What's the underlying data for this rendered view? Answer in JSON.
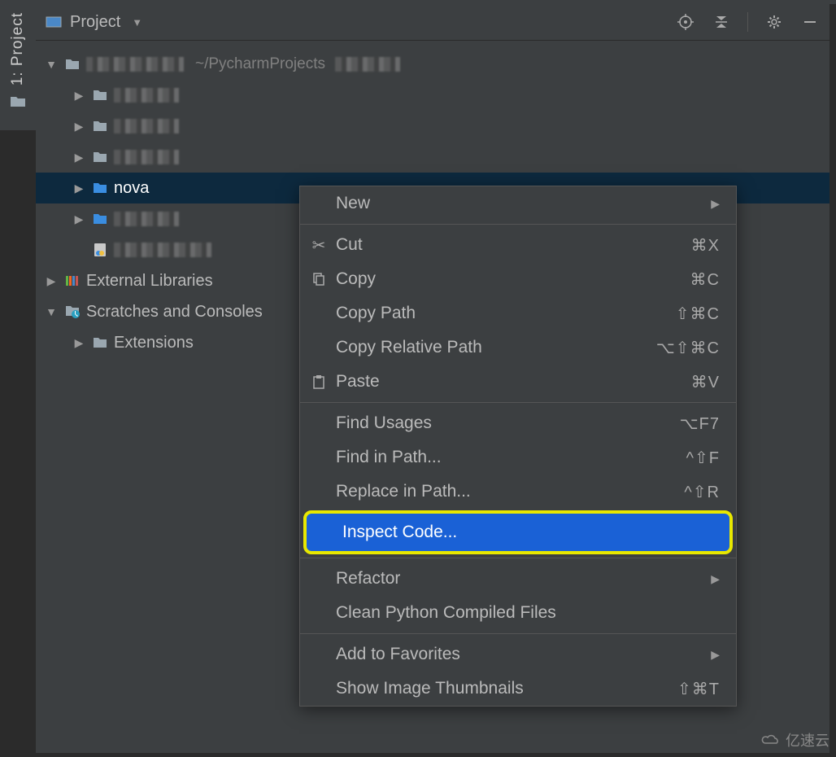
{
  "sidebar": {
    "tab_label": "1: Project"
  },
  "toolbar": {
    "title": "Project"
  },
  "tree": {
    "root_path": "~/PycharmProjects",
    "items": [
      {
        "label_blur": true
      },
      {
        "label_blur": true
      },
      {
        "label_blur": true
      },
      {
        "label": "nova",
        "selected": true
      },
      {
        "label_blur": true
      },
      {
        "python_file": true
      }
    ],
    "external": "External Libraries",
    "scratches": "Scratches and Consoles",
    "extensions": "Extensions"
  },
  "menu": {
    "new": "New",
    "cut": "Cut",
    "cut_sc": "⌘X",
    "copy": "Copy",
    "copy_sc": "⌘C",
    "copy_path": "Copy Path",
    "copy_path_sc": "⇧⌘C",
    "copy_rel": "Copy Relative Path",
    "copy_rel_sc": "⌥⇧⌘C",
    "paste": "Paste",
    "paste_sc": "⌘V",
    "find_usages": "Find Usages",
    "find_usages_sc": "⌥F7",
    "find_in_path": "Find in Path...",
    "find_in_path_sc": "^⇧F",
    "replace_in_path": "Replace in Path...",
    "replace_in_path_sc": "^⇧R",
    "inspect": "Inspect Code...",
    "refactor": "Refactor",
    "clean": "Clean Python Compiled Files",
    "add_fav": "Add to Favorites",
    "thumbnails": "Show Image Thumbnails",
    "thumbnails_sc": "⇧⌘T"
  },
  "watermark": "亿速云"
}
